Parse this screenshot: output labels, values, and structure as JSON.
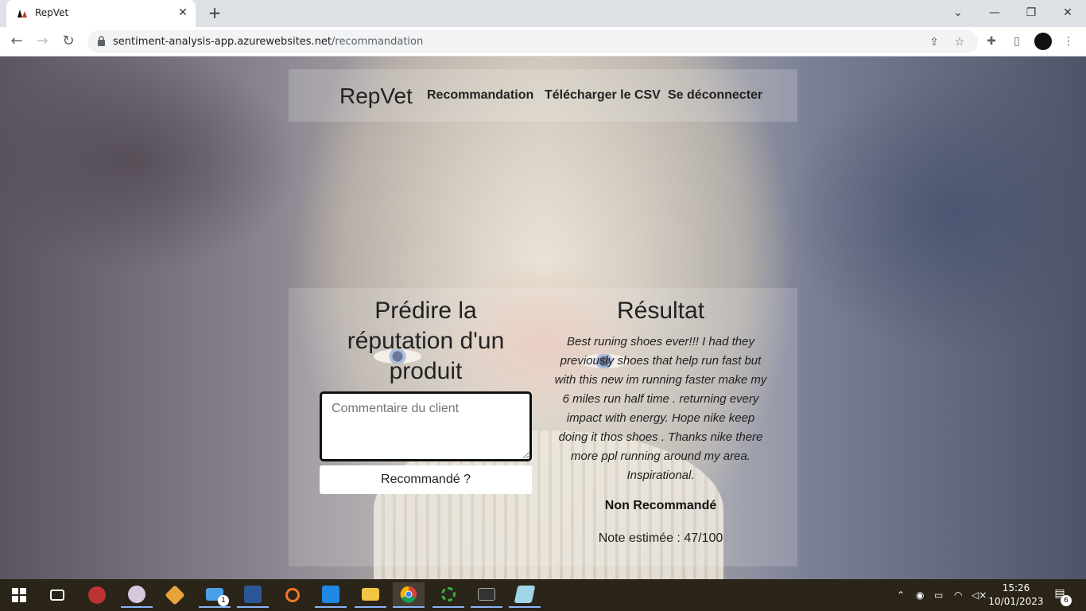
{
  "browser": {
    "tab_title": "RepVet",
    "tab_close_label": "✕",
    "new_tab_label": "+",
    "url_host": "sentiment-analysis-app.azurewebsites.net",
    "url_path": "/recommandation",
    "window_controls": {
      "list": "⌄",
      "minimize": "—",
      "restore": "❐",
      "close": "✕"
    },
    "nav": {
      "back": "←",
      "forward": "→",
      "reload": "↻"
    }
  },
  "site": {
    "brand": "RepVet",
    "nav": {
      "recommandation": "Recommandation",
      "csv": "Télécharger le CSV",
      "logout": "Se déconnecter"
    }
  },
  "predict": {
    "title": "Prédire la réputation d'un produit",
    "comment_placeholder": "Commentaire du client",
    "comment_value": "",
    "button_label": "Recommandé ?"
  },
  "result": {
    "title": "Résultat",
    "review": "Best runing shoes ever!!! I had they previously shoes that help run fast but with this new im running faster make my 6 miles run half time . returning every impact with energy. Hope nike keep doing it thos shoes . Thanks nike there more ppl running around my area. Inspirational.",
    "verdict": "Non Recommandé",
    "score": "Note estimée : 47/100"
  },
  "taskbar": {
    "time": "15:26",
    "date": "10/01/2023",
    "notification_count": "6",
    "mail_badge": "1"
  },
  "colors": {
    "taskbar": "#2b2418",
    "chrome_frame": "#dee1e6",
    "accent": "#8ab4f8"
  }
}
